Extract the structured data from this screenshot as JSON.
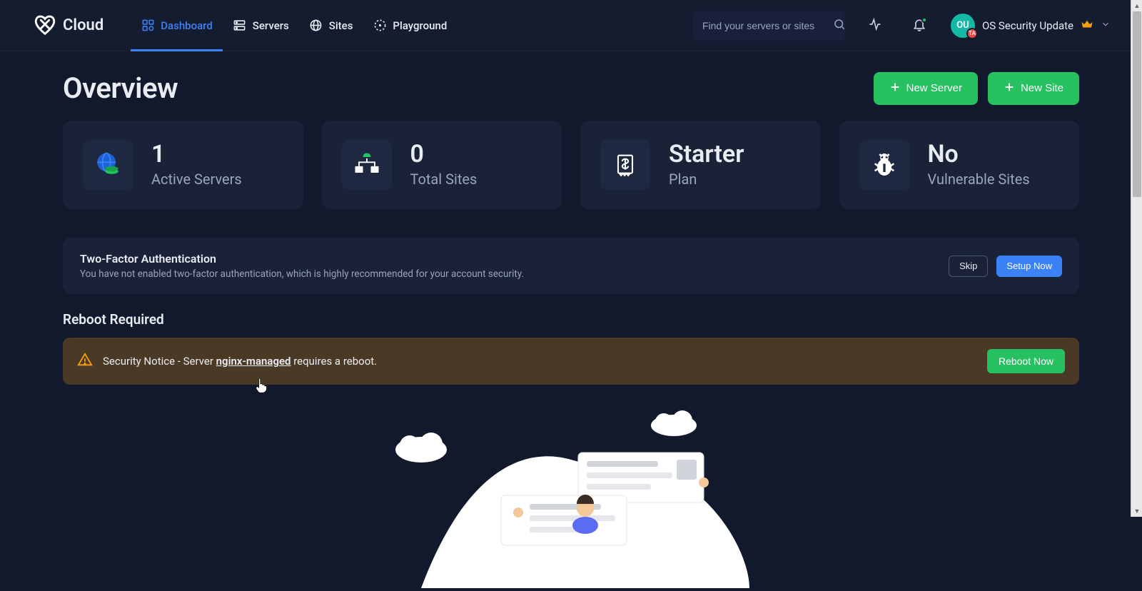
{
  "brand": "Cloud",
  "nav": {
    "dashboard": "Dashboard",
    "servers": "Servers",
    "sites": "Sites",
    "playground": "Playground"
  },
  "search": {
    "placeholder": "Find your servers or sites"
  },
  "user": {
    "initials": "OU",
    "badge": "TA",
    "name": "OS Security Update"
  },
  "page_title": "Overview",
  "actions": {
    "new_server": "New Server",
    "new_site": "New Site"
  },
  "stats": {
    "active_servers": {
      "value": "1",
      "label": "Active Servers"
    },
    "total_sites": {
      "value": "0",
      "label": "Total Sites"
    },
    "plan": {
      "value": "Starter",
      "label": "Plan"
    },
    "vulnerable": {
      "value": "No",
      "label": "Vulnerable Sites"
    }
  },
  "tfa": {
    "title": "Two-Factor Authentication",
    "desc": "You have not enabled two-factor authentication, which is highly recommended for your account security.",
    "skip": "Skip",
    "setup": "Setup Now"
  },
  "reboot": {
    "heading": "Reboot Required",
    "prefix": "Security Notice - Server ",
    "server": "nginx-managed",
    "suffix": " requires a reboot.",
    "button": "Reboot Now"
  }
}
